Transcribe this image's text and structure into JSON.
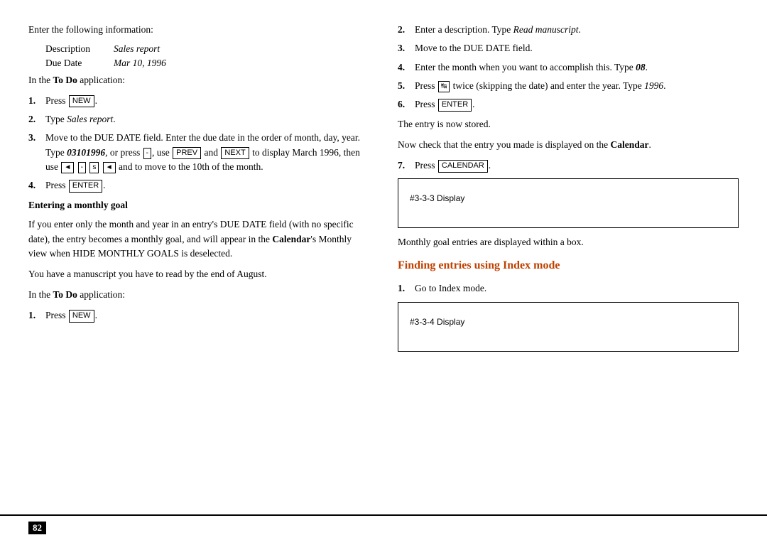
{
  "page": {
    "number": "82"
  },
  "left": {
    "intro": "Enter the following information:",
    "description_label": "Description",
    "description_value": "Sales report",
    "due_date_label": "Due Date",
    "due_date_value": "Mar 10, 1996",
    "app_intro": "In the To Do application:",
    "steps": [
      {
        "num": "1.",
        "text": "Press NEW."
      },
      {
        "num": "2.",
        "text": "Type Sales report."
      },
      {
        "num": "3.",
        "text": "Move to the DUE DATE field. Enter the due date in the order of month, day, year. Type 03101996, or press , use PREV and NEXT to display March 1996, then use and to move to the 10th of the month."
      },
      {
        "num": "4.",
        "text": "Press ENTER."
      }
    ],
    "entering_heading": "Entering a monthly goal",
    "entering_body1": "If you enter only the month and year in an entry's DUE DATE field (with no specific date), the entry becomes a monthly goal, and will appear in the Calendar's Monthly view when HIDE MONTHLY GOALS is deselected.",
    "entering_body2": "You have a manuscript you have to read by the end of August.",
    "app_intro2": "In the To Do application:",
    "steps2": [
      {
        "num": "1.",
        "text": "Press NEW."
      }
    ]
  },
  "right": {
    "steps_top": [
      {
        "num": "2.",
        "text": "Enter a description. Type Read manuscript."
      },
      {
        "num": "3.",
        "text": "Move to the DUE DATE field."
      },
      {
        "num": "4.",
        "text": "Enter the month when you want to accomplish this. Type 08."
      },
      {
        "num": "5.",
        "text": "Press twice (skipping the date) and enter the year. Type 1996."
      },
      {
        "num": "6.",
        "text": "Press ENTER."
      }
    ],
    "stored_text": "The entry is now stored.",
    "check_text": "Now check that the entry you made is displayed on the Calendar.",
    "steps_mid": [
      {
        "num": "7.",
        "text": "Press CALENDAR."
      }
    ],
    "display_box_1": "#3-3-3 Display",
    "monthly_text": "Monthly goal entries are displayed within a box.",
    "finding_heading": "Finding entries using Index mode",
    "steps_finding": [
      {
        "num": "1.",
        "text": "Go to Index mode."
      }
    ],
    "display_box_2": "#3-3-4 Display"
  }
}
